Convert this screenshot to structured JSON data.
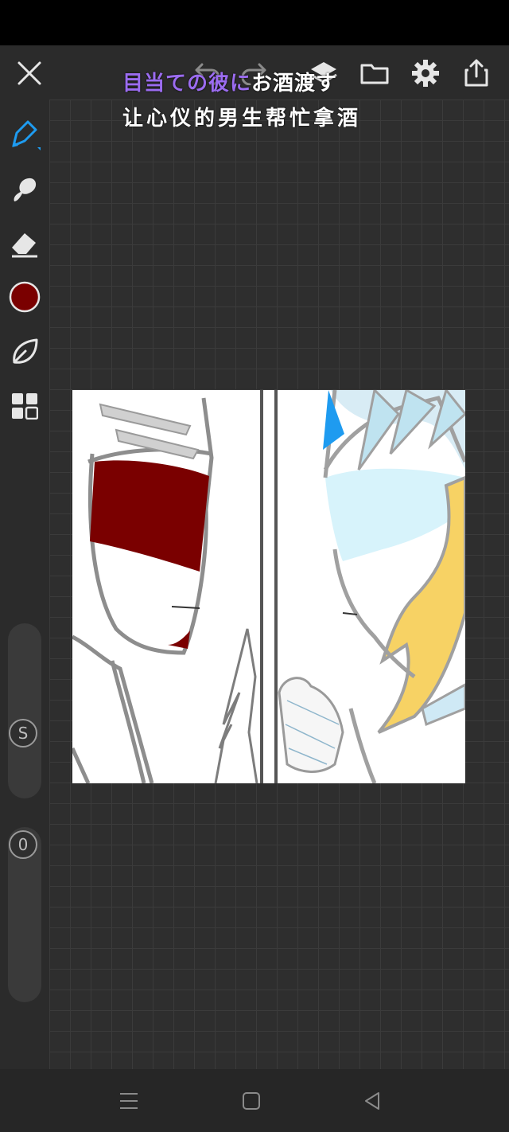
{
  "overlay": {
    "line1_purple": "目当ての彼に",
    "line1_white": "お酒渡す",
    "line2": "让心仪的男生帮忙拿酒"
  },
  "toolbar": {
    "icons": [
      "close-icon",
      "undo-icon",
      "redo-icon",
      "layers-icon",
      "folder-icon",
      "gear-icon",
      "share-icon"
    ]
  },
  "tools": {
    "icons": [
      "brush-icon",
      "smudge-icon",
      "eraser-icon",
      "color-swatch",
      "leaf-icon",
      "grid-icon"
    ],
    "active_color": "#7a0000",
    "accent_color": "#1e9bf0"
  },
  "sliders": {
    "size_label": "S",
    "opacity_label": "0"
  },
  "navbar": {
    "icons": [
      "menu-icon",
      "home-square-icon",
      "back-triangle-icon"
    ]
  }
}
